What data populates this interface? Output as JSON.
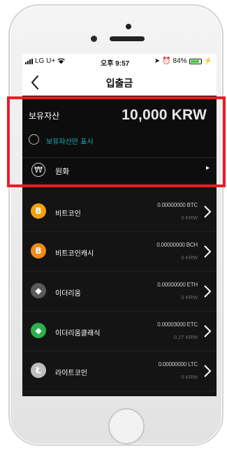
{
  "status_bar": {
    "carrier": "LG U+",
    "time": "오후 9:57",
    "battery": "84%",
    "battery_level": 0.84
  },
  "nav": {
    "title": "입출금",
    "back_icon": "chevron-left-icon"
  },
  "summary": {
    "label": "보유자산",
    "amount": "10,000 KRW",
    "filter_label": "보유자산만 표시",
    "filter_checked": false,
    "krw_icon": "₩",
    "krw_label": "원화",
    "krw_arrow": "▸"
  },
  "colors": {
    "background": "#141414",
    "accent_teal": "#19b3c6",
    "highlight": "#ee1b24"
  },
  "coins": [
    {
      "name": "비트코인",
      "amount": "0.00000000 BTC",
      "krw": "0 KRW",
      "icon": "bitcoin-icon",
      "icon_color": "#f2a20e",
      "glyph": "B"
    },
    {
      "name": "비트코인캐시",
      "amount": "0.00000000 BCH",
      "krw": "0 KRW",
      "icon": "bitcoin-cash-icon",
      "icon_color": "#f08a1a",
      "glyph": "B"
    },
    {
      "name": "이더리움",
      "amount": "0.00000000 ETH",
      "krw": "0 KRW",
      "icon": "ethereum-icon",
      "icon_color": "#5a5a5a",
      "glyph": "◆"
    },
    {
      "name": "이더리움클래식",
      "amount": "0.00003000 ETC",
      "krw": "0.27 KRW",
      "icon": "ethereum-classic-icon",
      "icon_color": "#2bb24c",
      "glyph": "◆"
    },
    {
      "name": "라이트코인",
      "amount": "0.00000000 LTC",
      "krw": "0 KRW",
      "icon": "litecoin-icon",
      "icon_color": "#bebebe",
      "glyph": "Ł"
    }
  ]
}
